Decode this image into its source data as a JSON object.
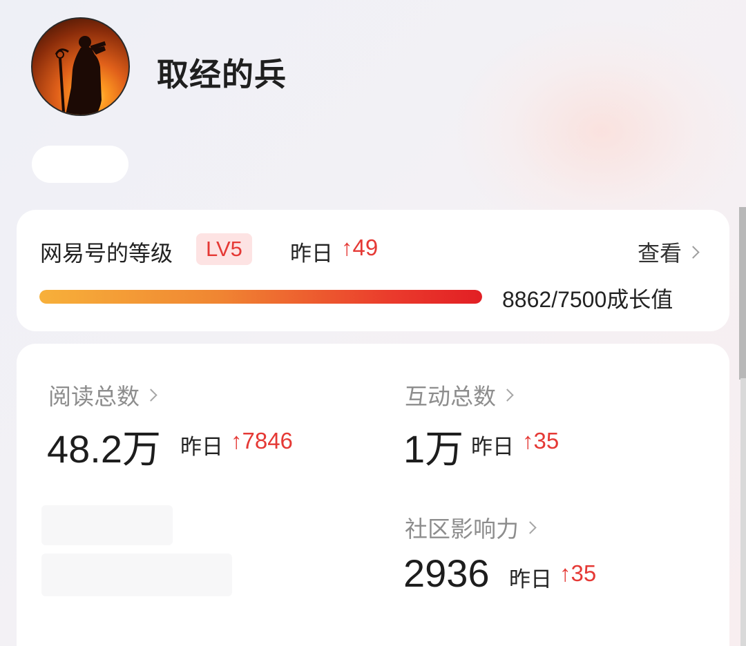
{
  "profile": {
    "username": "取经的兵",
    "avatar_icon": "monk-silhouette-sunset-avatar"
  },
  "level": {
    "title": "网易号的等级",
    "badge": "LV5",
    "yesterday_label": "昨日",
    "yesterday_change": "↑49",
    "view_label": "查看",
    "progress_text": "8862/7500成长值",
    "progress_fraction": 1.0
  },
  "stats": {
    "reads": {
      "label": "阅读总数",
      "value": "48.2万",
      "yesterday_label": "昨日",
      "change": "↑7846"
    },
    "interactions": {
      "label": "互动总数",
      "value": "1万",
      "yesterday_label": "昨日",
      "change": "↑35"
    },
    "influence": {
      "label": "社区影响力",
      "value": "2936",
      "yesterday_label": "昨日",
      "change": "↑35"
    }
  },
  "colors": {
    "accent_red": "#e53935",
    "badge_bg": "#fde3e3",
    "progress_start": "#f7b03a",
    "progress_end": "#e21f24"
  }
}
